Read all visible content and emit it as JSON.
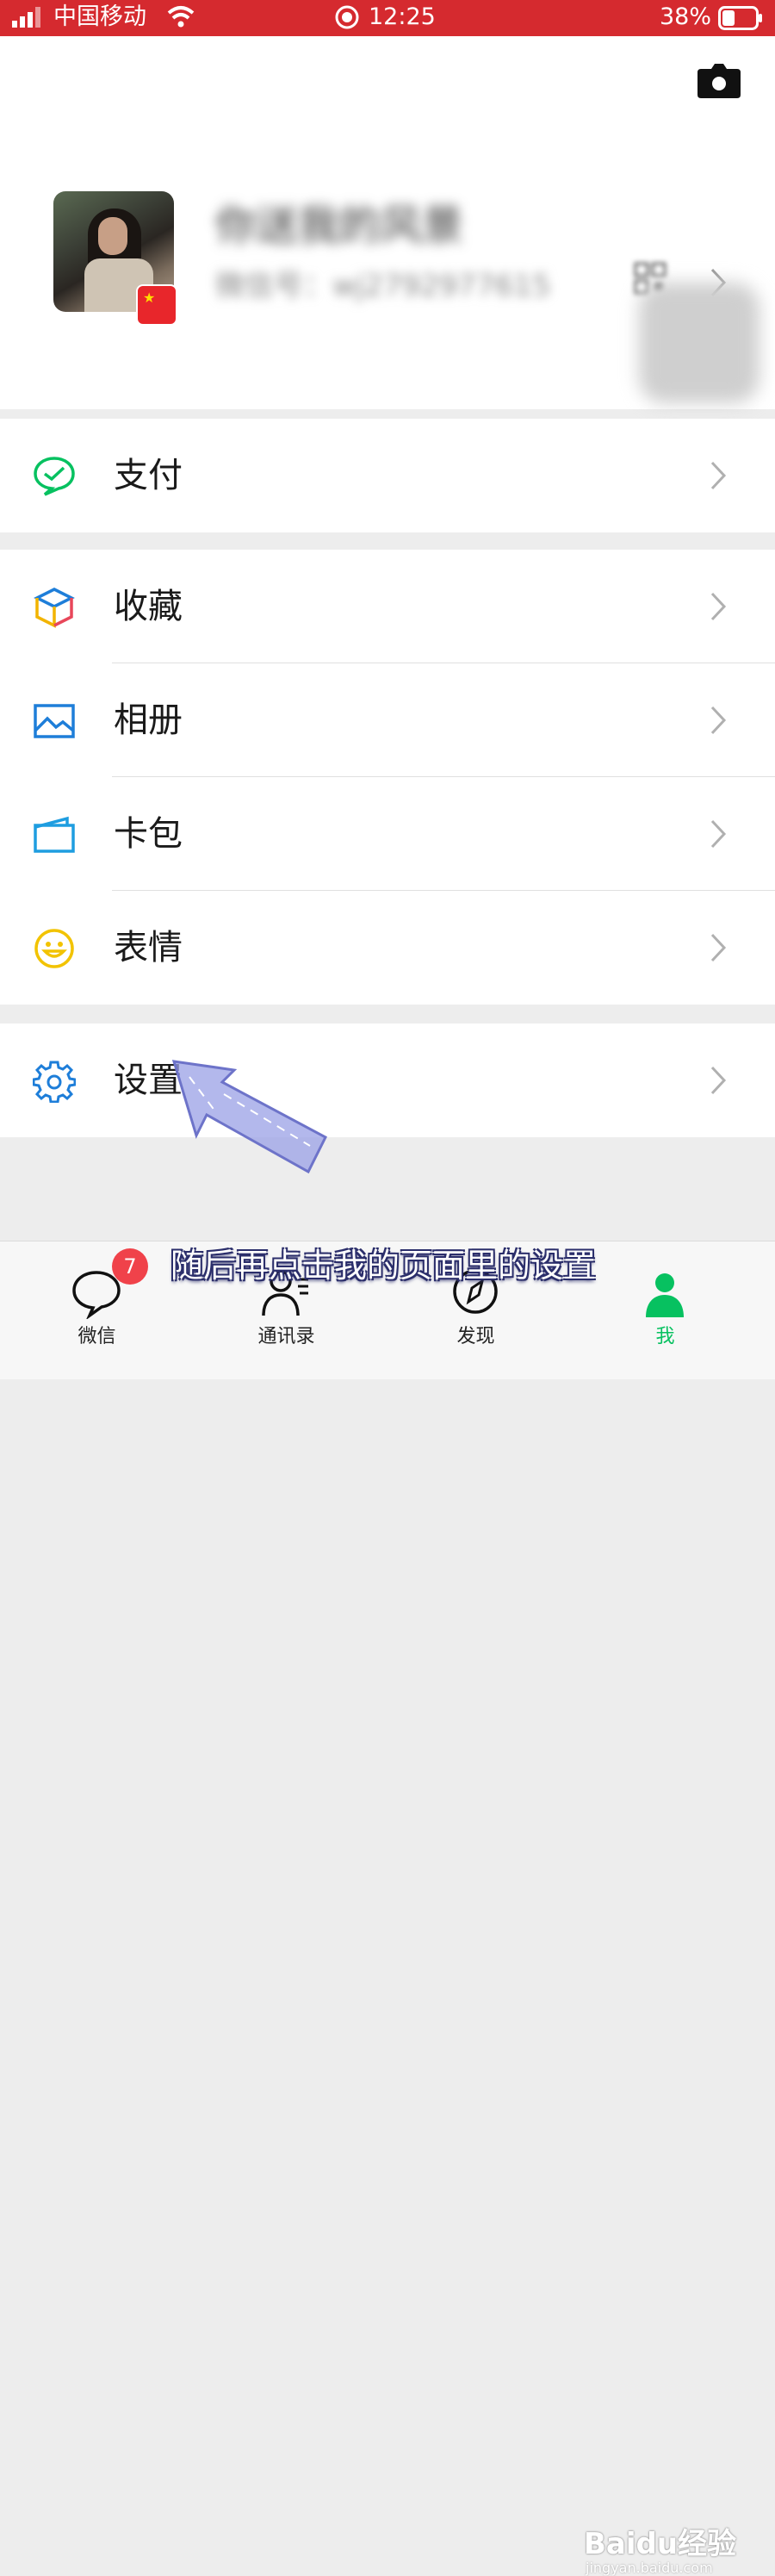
{
  "status_bar": {
    "carrier": "中国移动",
    "time": "12:25",
    "battery_percent": "38%",
    "battery_level": 0.38
  },
  "profile": {
    "nickname": "你送我的风景",
    "wechat_id": "微信号：wj2792977615"
  },
  "menu": {
    "pay": {
      "label": "支付",
      "icon": "wechat-pay-icon"
    },
    "favorites": {
      "label": "收藏",
      "icon": "cube-icon"
    },
    "album": {
      "label": "相册",
      "icon": "image-icon"
    },
    "cards": {
      "label": "卡包",
      "icon": "card-icon"
    },
    "stickers": {
      "label": "表情",
      "icon": "smiley-icon"
    },
    "settings": {
      "label": "设置",
      "icon": "gear-icon"
    }
  },
  "subtitle": "随后再点击我的页面里的设置",
  "tab_bar": {
    "chats": {
      "label": "微信",
      "badge": "7"
    },
    "contacts": {
      "label": "通讯录"
    },
    "discover": {
      "label": "发现"
    },
    "me": {
      "label": "我"
    }
  },
  "watermark": {
    "brand": "Baidu经验",
    "url": "jingyan.baidu.com"
  },
  "colors": {
    "status_bar": "#d52a2f",
    "wechat_green": "#07c160",
    "settings_blue": "#1e7ed9"
  }
}
